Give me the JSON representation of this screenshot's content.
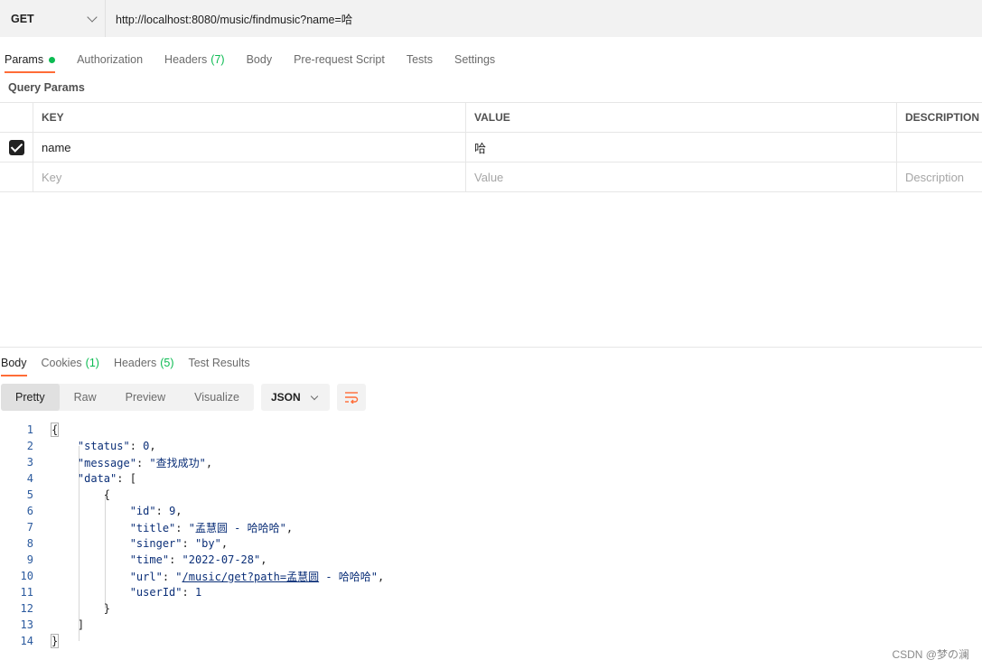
{
  "request": {
    "method": "GET",
    "url": "http://localhost:8080/music/findmusic?name=哈"
  },
  "request_tabs": [
    {
      "label": "Params",
      "count": "",
      "active": true
    },
    {
      "label": "Authorization",
      "count": ""
    },
    {
      "label": "Headers",
      "count": "(7)"
    },
    {
      "label": "Body",
      "count": ""
    },
    {
      "label": "Pre-request Script",
      "count": ""
    },
    {
      "label": "Tests",
      "count": ""
    },
    {
      "label": "Settings",
      "count": ""
    }
  ],
  "query_params": {
    "title": "Query Params",
    "headers": {
      "key": "KEY",
      "value": "VALUE",
      "description": "DESCRIPTION"
    },
    "row": {
      "key": "name",
      "value": "哈",
      "description": ""
    },
    "placeholders": {
      "key": "Key",
      "value": "Value",
      "description": "Description"
    }
  },
  "response_tabs": [
    {
      "label": "Body",
      "count": ""
    },
    {
      "label": "Cookies",
      "count": "(1)"
    },
    {
      "label": "Headers",
      "count": "(5)"
    },
    {
      "label": "Test Results",
      "count": ""
    }
  ],
  "view_modes": [
    "Pretty",
    "Raw",
    "Preview",
    "Visualize"
  ],
  "format": "JSON",
  "code": {
    "line_numbers": [
      "1",
      "2",
      "3",
      "4",
      "5",
      "6",
      "7",
      "8",
      "9",
      "10",
      "11",
      "12",
      "13",
      "14"
    ],
    "status_key": "\"status\"",
    "status_val": "0",
    "message_key": "\"message\"",
    "message_val": "\"查找成功\"",
    "data_key": "\"data\"",
    "id_key": "\"id\"",
    "id_val": "9",
    "title_key": "\"title\"",
    "title_val": "\"孟慧圆 - 哈哈哈\"",
    "singer_key": "\"singer\"",
    "singer_val": "\"by\"",
    "time_key": "\"time\"",
    "time_val": "\"2022-07-28\"",
    "url_key": "\"url\"",
    "url_link": "/music/get?path=孟慧圆",
    "url_rest": " - 哈哈哈\"",
    "userid_key": "\"userId\"",
    "userid_val": "1"
  },
  "watermark": "CSDN @梦の澜"
}
